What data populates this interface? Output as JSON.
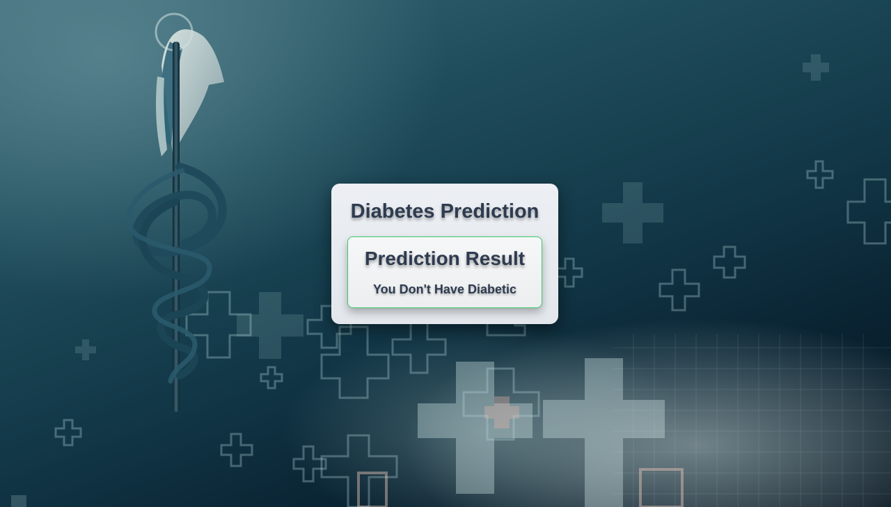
{
  "app": {
    "title": "Diabetes Prediction"
  },
  "result": {
    "heading": "Prediction Result",
    "message": "You Don't Have Diabetic",
    "status_color": "#3cc86a"
  },
  "background": {
    "icons": [
      "caduceus-icon",
      "medical-cross-icon"
    ],
    "colors": {
      "dark": "#06141f",
      "teal": "#1f4c5b",
      "light": "#c8d7d7"
    }
  }
}
